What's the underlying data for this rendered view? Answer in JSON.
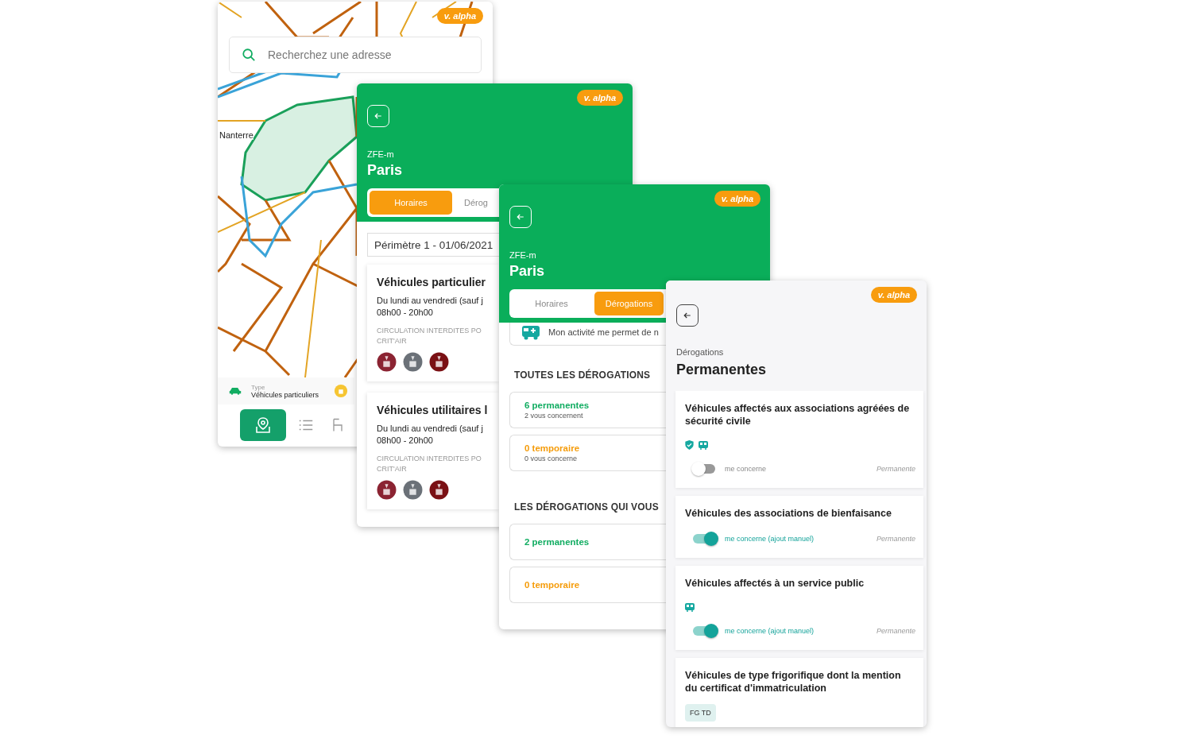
{
  "map_screen": {
    "version_badge": "v. alpha",
    "search": {
      "placeholder": "Recherchez une adresse"
    },
    "place_label": "Nanterre",
    "type_selector": {
      "label": "Type",
      "value": "Véhicules particuliers"
    },
    "bottom_nav": [
      {
        "kind": "map",
        "selected": true
      },
      {
        "kind": "list",
        "selected": false
      },
      {
        "kind": "other",
        "selected": false
      }
    ]
  },
  "zone_screen": {
    "version_badge": "v. alpha",
    "subtitle": "ZFE-m",
    "title": "Paris",
    "tabs": [
      {
        "label": "Horaires",
        "selected": true
      },
      {
        "label": "Dérog",
        "selected": false
      }
    ],
    "perimeter_select": {
      "value": "Périmètre 1 - 01/06/2021"
    },
    "rules": [
      {
        "title": "Véhicules particulier",
        "days": "Du lundi au vendredi (sauf j",
        "hours": "08h00 - 20h00",
        "restriction_lines": [
          "CIRCULATION INTERDITES PO",
          "CRIT'AIR"
        ],
        "stickers": [
          {
            "color": "#8b2332"
          },
          {
            "color": "#6b7178"
          },
          {
            "color": "#7a1014"
          }
        ]
      },
      {
        "title": "Véhicules utilitaires l",
        "days": "Du lundi au vendredi (sauf j",
        "hours": "08h00 - 20h00",
        "restriction_lines": [
          "CIRCULATION INTERDITES PO",
          "CRIT'AIR"
        ],
        "stickers": [
          {
            "color": "#8b2332"
          },
          {
            "color": "#6b7178"
          },
          {
            "color": "#7a1014"
          }
        ]
      }
    ]
  },
  "derogations_screen": {
    "version_badge": "v. alpha",
    "subtitle": "ZFE-m",
    "title": "Paris",
    "tabs": [
      {
        "label": "Horaires",
        "selected": false
      },
      {
        "label": "Dérogations",
        "selected": true
      }
    ],
    "activity_row": {
      "text": "Mon activité me permet de n"
    },
    "sections": [
      {
        "heading": "TOUTES LES DÉROGATIONS",
        "items": [
          {
            "kind": "permanent",
            "count": "6 permanentes",
            "detail": "2 vous concernent"
          },
          {
            "kind": "temporary",
            "count": "0 temporaire",
            "detail": "0 vous concerne"
          }
        ]
      },
      {
        "heading": "LES DÉROGATIONS QUI VOUS",
        "items": [
          {
            "kind": "permanent",
            "count": "2 permanentes"
          },
          {
            "kind": "temporary",
            "count": "0 temporaire"
          }
        ]
      }
    ]
  },
  "permanent_screen": {
    "version_badge": "v. alpha",
    "subtitle": "Dérogations",
    "title": "Permanentes",
    "items": [
      {
        "title": "Véhicules affectés aux associations agréées de sécurité civile",
        "icons": [
          {
            "kind": "shield"
          },
          {
            "kind": "bus"
          }
        ],
        "toggle": {
          "on": false,
          "label": "me concerne"
        },
        "type": "Permanente"
      },
      {
        "title": "Véhicules des associations de bienfaisance",
        "toggle": {
          "on": true,
          "label": "me concerne (ajout manuel)"
        },
        "type": "Permanente"
      },
      {
        "title": "Véhicules affectés à un service public",
        "icons": [
          {
            "kind": "bus"
          }
        ],
        "toggle": {
          "on": true,
          "label": "me concerne (ajout manuel)"
        },
        "type": "Permanente"
      },
      {
        "title": "Véhicules de type frigorifique dont la mention du certificat d'immatriculation",
        "tags": [
          "FG TD"
        ]
      }
    ]
  }
}
